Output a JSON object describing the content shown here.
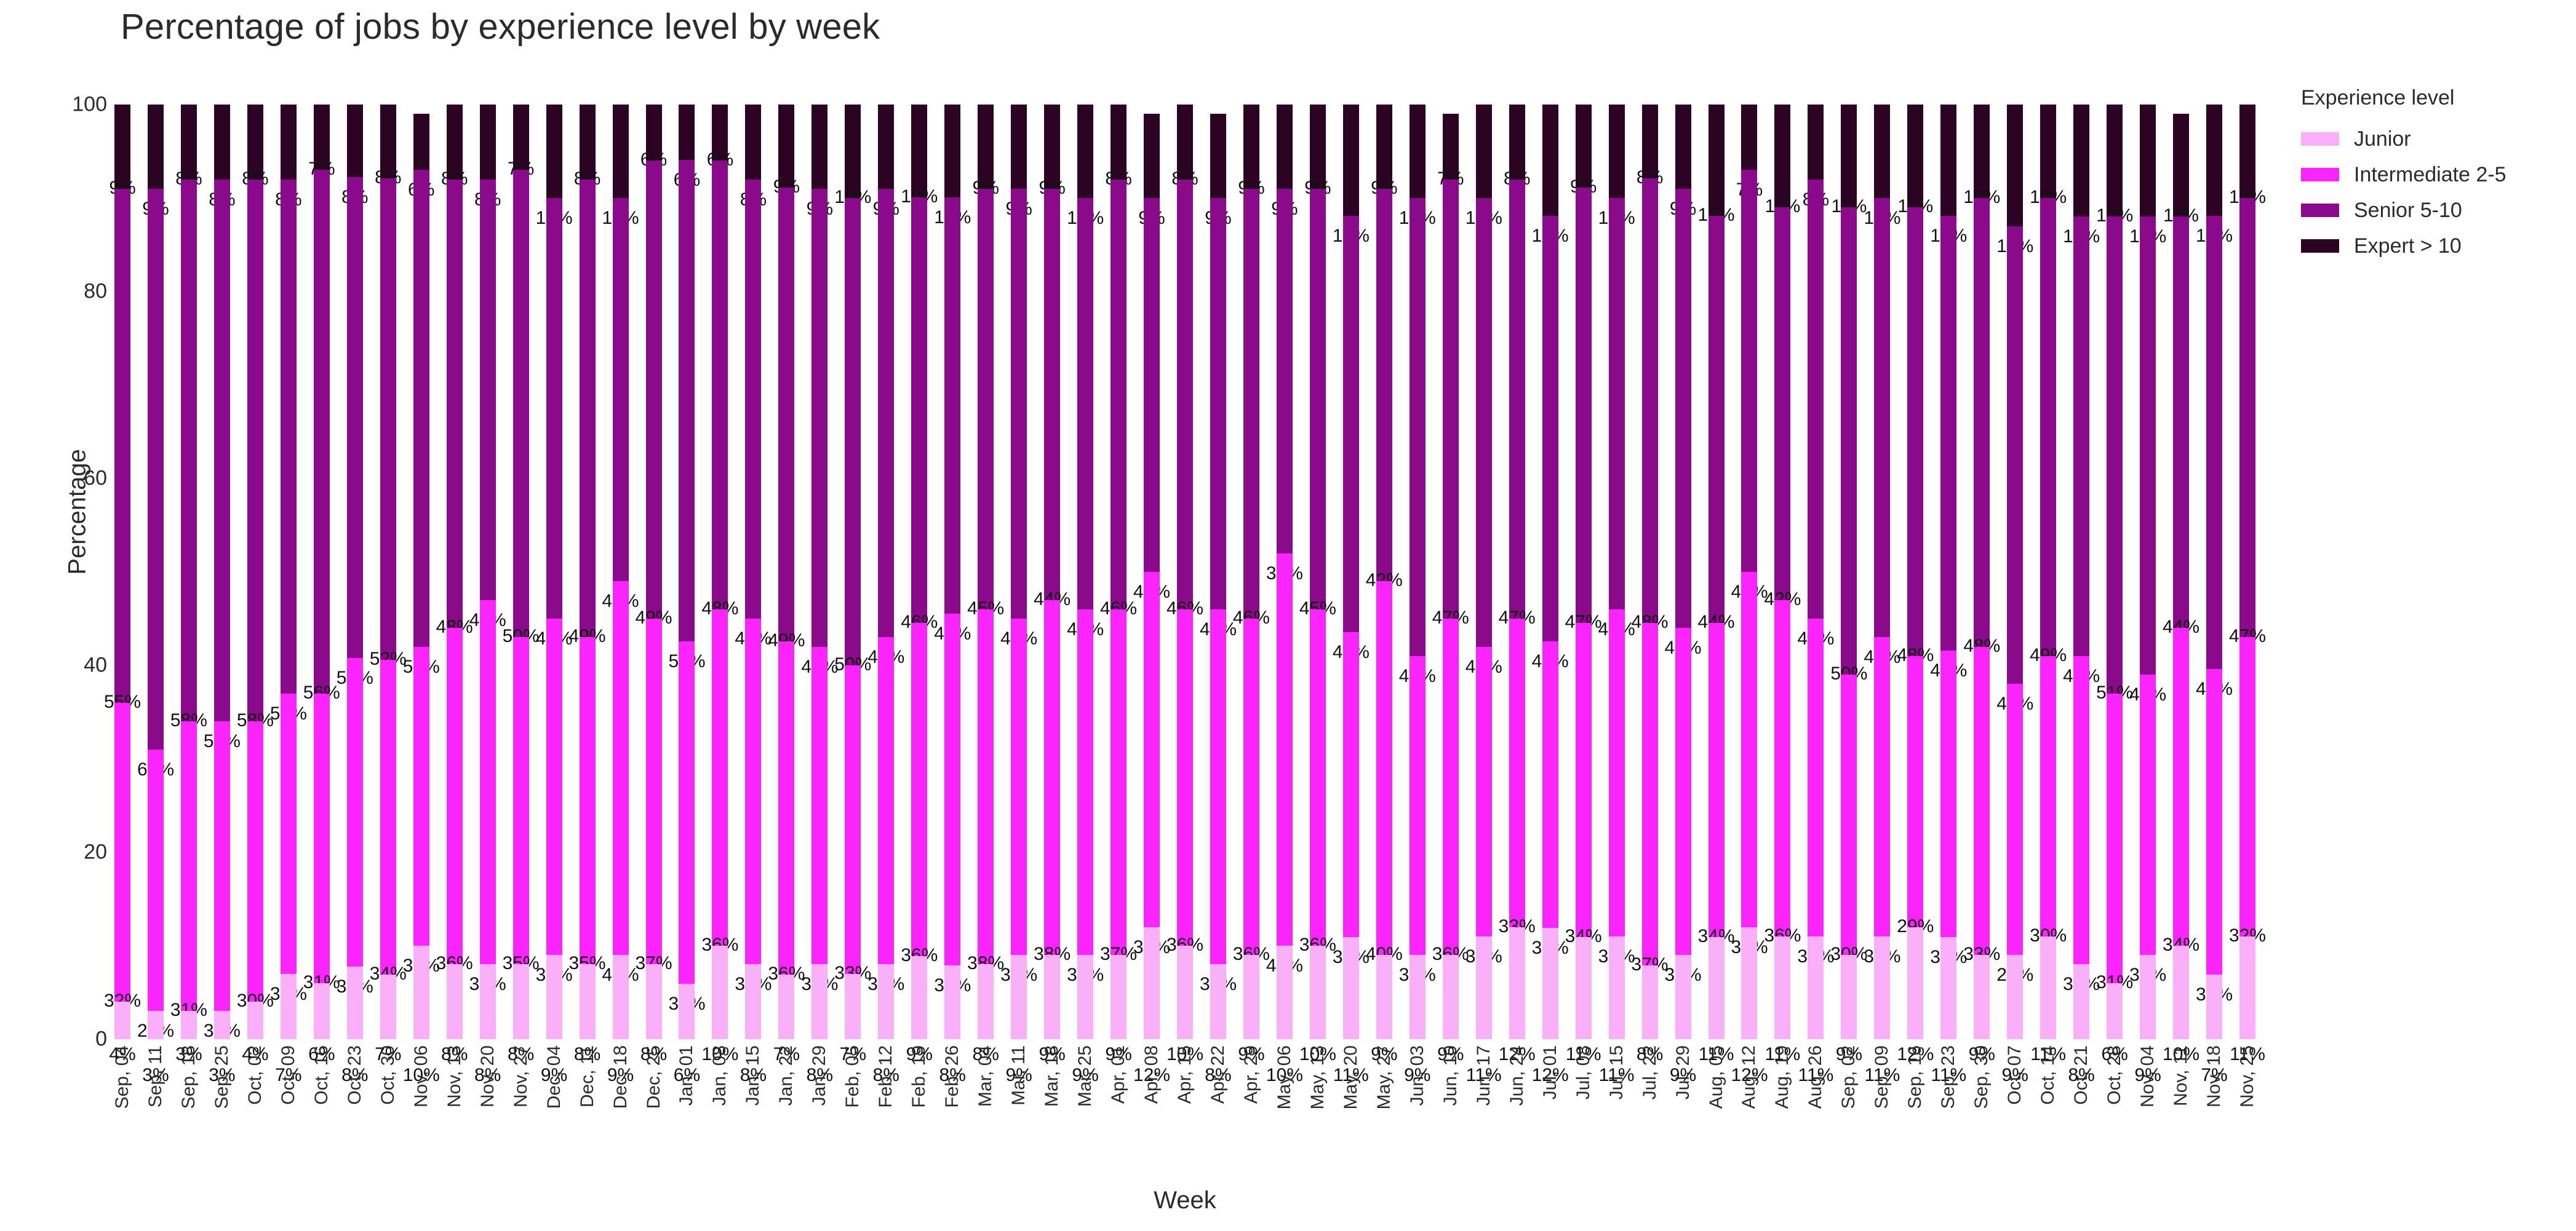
{
  "chart_title": "Percentage of jobs by experience level by week",
  "axes": {
    "ylabel": "Percentage",
    "xlabel": "Week",
    "yticks": [
      "0",
      "20",
      "40",
      "60",
      "80",
      "100"
    ],
    "ylim": [
      0,
      100
    ]
  },
  "legend": {
    "title": "Experience level",
    "position": "right",
    "entries": [
      {
        "label": "Junior",
        "color": "#f9b0f9"
      },
      {
        "label": "Intermediate 2-5",
        "color": "#fc24fc"
      },
      {
        "label": "Senior 5-10",
        "color": "#8b0a8b"
      },
      {
        "label": "Expert > 10",
        "color": "#2c0323"
      }
    ]
  },
  "chart_data": {
    "type": "bar",
    "stacked": true,
    "normalized": true,
    "title": "Percentage of jobs by experience level by week",
    "xlabel": "Week",
    "ylabel": "Percentage",
    "ylim": [
      0,
      100
    ],
    "grid": false,
    "legend_position": "right",
    "categories": [
      "Sep, 04",
      "Sep, 11",
      "Sep, 18",
      "Sep, 25",
      "Oct, 02",
      "Oct, 09",
      "Oct, 16",
      "Oct, 23",
      "Oct, 30",
      "Nov, 06",
      "Nov, 13",
      "Nov, 20",
      "Nov, 27",
      "Dec, 04",
      "Dec, 11",
      "Dec, 18",
      "Dec, 25",
      "Jan, 01",
      "Jan, 08",
      "Jan, 15",
      "Jan, 22",
      "Jan, 29",
      "Feb, 05",
      "Feb, 12",
      "Feb, 19",
      "Feb, 26",
      "Mar, 04",
      "Mar, 11",
      "Mar, 18",
      "Mar, 25",
      "Apr, 01",
      "Apr, 08",
      "Apr, 15",
      "Apr, 22",
      "Apr, 29",
      "May, 06",
      "May, 13",
      "May, 20",
      "May, 27",
      "Jun, 03",
      "Jun, 10",
      "Jun, 17",
      "Jun, 24",
      "Jul, 01",
      "Jul, 08",
      "Jul, 15",
      "Jul, 22",
      "Jul, 29",
      "Aug, 05",
      "Aug, 12",
      "Aug, 19",
      "Aug, 26",
      "Sep, 02",
      "Sep, 09",
      "Sep, 16",
      "Sep, 23",
      "Sep, 30",
      "Oct, 07",
      "Oct, 14",
      "Oct, 21",
      "Oct, 28",
      "Nov, 04",
      "Nov, 11",
      "Nov, 18",
      "Nov, 25"
    ],
    "series": [
      {
        "name": "Junior",
        "color": "#f9b0f9",
        "values": [
          4,
          3,
          3,
          3,
          4,
          7,
          6,
          8,
          7,
          10,
          8,
          8,
          8,
          9,
          8,
          9,
          8,
          6,
          10,
          8,
          7,
          8,
          7,
          8,
          9,
          8,
          8,
          9,
          9,
          9,
          9,
          12,
          10,
          8,
          9,
          10,
          10,
          11,
          9,
          9,
          9,
          11,
          12,
          12,
          11,
          11,
          8,
          9,
          11,
          12,
          11,
          11,
          9,
          11,
          12,
          11,
          9,
          9,
          11,
          8,
          6,
          9,
          10,
          7,
          11
        ]
      },
      {
        "name": "Intermediate 2-5",
        "color": "#fc24fc",
        "values": [
          32,
          28,
          31,
          31,
          30,
          30,
          31,
          34,
          34,
          32,
          36,
          39,
          35,
          36,
          35,
          40,
          37,
          37,
          36,
          37,
          36,
          34,
          33,
          35,
          36,
          38,
          38,
          36,
          38,
          37,
          37,
          38,
          36,
          38,
          36,
          42,
          36,
          33,
          40,
          32,
          36,
          31,
          33,
          31,
          34,
          35,
          37,
          35,
          34,
          38,
          36,
          34,
          30,
          32,
          29,
          31,
          33,
          29,
          30,
          33,
          31,
          30,
          34,
          33,
          32
        ]
      },
      {
        "name": "Senior 5-10",
        "color": "#8b0a8b",
        "values": [
          55,
          60,
          58,
          58,
          58,
          55,
          56,
          53,
          52,
          51,
          48,
          45,
          50,
          45,
          49,
          41,
          49,
          52,
          48,
          47,
          49,
          49,
          50,
          48,
          46,
          45,
          45,
          46,
          44,
          44,
          46,
          40,
          46,
          44,
          46,
          39,
          45,
          45,
          42,
          49,
          47,
          48,
          47,
          46,
          47,
          44,
          48,
          47,
          44,
          43,
          42,
          47,
          50,
          47,
          48,
          47,
          48,
          49,
          49,
          47,
          51,
          49,
          44,
          49,
          47
        ]
      },
      {
        "name": "Expert > 10",
        "color": "#2c0323",
        "values": [
          9,
          9,
          8,
          8,
          8,
          8,
          7,
          8,
          8,
          6,
          8,
          8,
          7,
          10,
          8,
          10,
          6,
          6,
          6,
          8,
          9,
          9,
          10,
          9,
          10,
          10,
          9,
          9,
          9,
          10,
          8,
          9,
          8,
          9,
          9,
          9,
          9,
          12,
          9,
          10,
          7,
          10,
          8,
          12,
          9,
          10,
          8,
          9,
          12,
          7,
          11,
          8,
          11,
          10,
          11,
          12,
          10,
          13,
          10,
          12,
          12,
          12,
          11,
          12,
          10
        ]
      }
    ]
  }
}
